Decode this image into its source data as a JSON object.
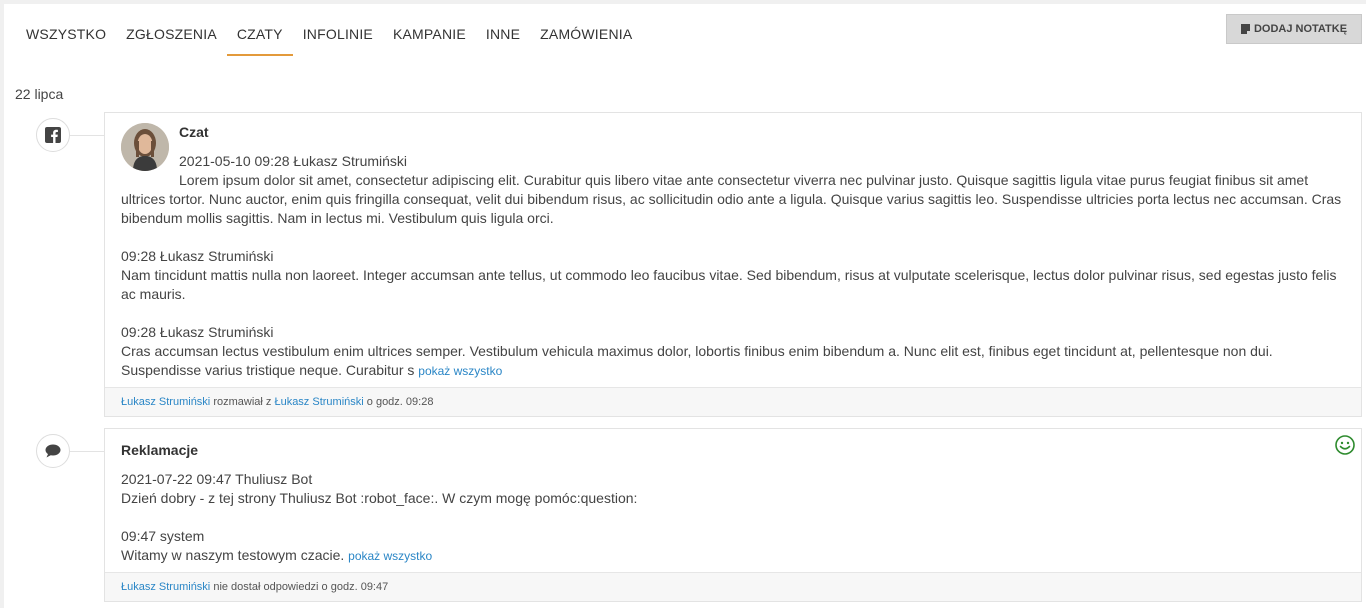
{
  "tabs": [
    "WSZYSTKO",
    "ZGŁOSZENIA",
    "CZATY",
    "INFOLINIE",
    "KAMPANIE",
    "INNE",
    "ZAMÓWIENIA"
  ],
  "active_tab": "CZATY",
  "add_note_label": "DODAJ NOTATKĘ",
  "date_label": "22 lipca",
  "show_all_label": "pokaż wszystko",
  "card1": {
    "icon": "facebook-icon",
    "title": "Czat",
    "messages": [
      {
        "header": "2021-05-10 09:28 Łukasz Strumiński",
        "text": "Lorem ipsum dolor sit amet, consectetur adipiscing elit. Curabitur quis libero vitae ante consectetur viverra nec pulvinar justo. Quisque sagittis ligula vitae purus feugiat finibus sit amet ultrices tortor. Nunc auctor, enim quis fringilla consequat, velit dui bibendum risus, ac sollicitudin odio ante a ligula. Quisque varius sagittis leo. Suspendisse ultricies porta lectus nec accumsan. Cras bibendum mollis sagittis. Nam in lectus mi. Vestibulum quis ligula orci."
      },
      {
        "header": "09:28 Łukasz Strumiński",
        "text": "Nam tincidunt mattis nulla non laoreet. Integer accumsan ante tellus, ut commodo leo faucibus vitae. Sed bibendum, risus at vulputate scelerisque, lectus dolor pulvinar risus, sed egestas justo felis ac mauris."
      },
      {
        "header": "09:28 Łukasz Strumiński",
        "text": "Cras accumsan lectus vestibulum enim ultrices semper. Vestibulum vehicula maximus dolor, lobortis finibus enim bibendum a. Nunc elit est, finibus eget tincidunt at, pellentesque non dui. Suspendisse varius tristique neque. Curabitur s"
      }
    ],
    "footer": {
      "user1": "Łukasz Strumiński",
      "mid": " rozmawiał z ",
      "user2": "Łukasz Strumiński",
      "end": " o godz. 09:28"
    }
  },
  "card2": {
    "icon": "chat-bubble-icon",
    "title": "Reklamacje",
    "sentiment_icon": "smiley-icon",
    "sentiment_color": "#2e8b2e",
    "messages": [
      {
        "header": "2021-07-22 09:47 Thuliusz Bot",
        "text": "Dzień dobry - z tej strony Thuliusz Bot :robot_face:. W czym mogę pomóc:question:"
      },
      {
        "header": "09:47 system",
        "text": "Witamy w naszym testowym czacie. "
      }
    ],
    "footer": {
      "user1": "Łukasz Strumiński",
      "end": " nie dostał odpowiedzi o godz. 09:47"
    }
  }
}
